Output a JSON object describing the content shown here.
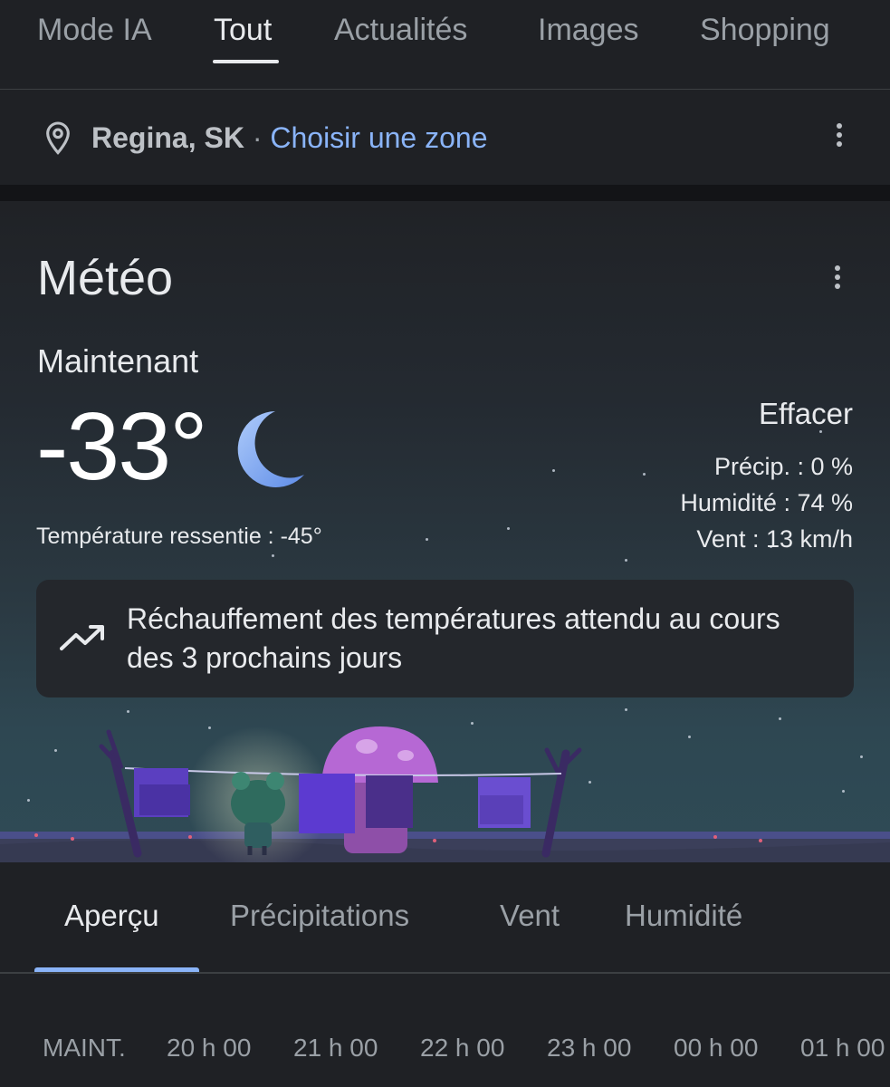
{
  "search_tabs": [
    {
      "label": "Mode IA"
    },
    {
      "label": "Tout"
    },
    {
      "label": "Actualités"
    },
    {
      "label": "Images"
    },
    {
      "label": "Shopping"
    }
  ],
  "active_tab": "Tout",
  "location": {
    "city": "Regina, SK",
    "separator": "·",
    "change_label": "Choisir une zone"
  },
  "weather": {
    "title": "Météo",
    "now_label": "Maintenant",
    "temperature": "-33°",
    "condition_icon": "moon-icon",
    "feels_like": "Température ressentie : -45°",
    "condition": "Effacer",
    "precip": "Précip. : 0 %",
    "humidity": "Humidité : 74 %",
    "wind": "Vent : 13 km/h",
    "alert": "Réchauffement des températures attendu au cours des 3 prochains jours"
  },
  "detail_tabs": [
    {
      "label": "Aperçu"
    },
    {
      "label": "Précipitations"
    },
    {
      "label": "Vent"
    },
    {
      "label": "Humidité"
    }
  ],
  "active_detail_tab": "Aperçu",
  "hourly": [
    {
      "label": "MAINT."
    },
    {
      "label": "20 h 00"
    },
    {
      "label": "21 h 00"
    },
    {
      "label": "22 h 00"
    },
    {
      "label": "23 h 00"
    },
    {
      "label": "00 h 00"
    },
    {
      "label": "01 h 00"
    }
  ],
  "colors": {
    "background": "#1f2125",
    "link_blue": "#8ab4f8",
    "moon_blue": "#8ab4f8"
  }
}
